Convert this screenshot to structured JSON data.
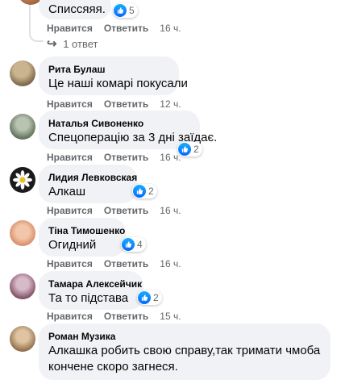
{
  "colors": {
    "bubble": "#f0f2f5",
    "action_text": "#65676b",
    "like_blue": "#0866ff"
  },
  "labels": {
    "like": "Нравится",
    "reply": "Ответить"
  },
  "top_comment": {
    "text": "Списсяяя.",
    "reactions": "5",
    "time": "16 ч.",
    "replies_link": "1 ответ"
  },
  "comments": [
    {
      "author": "Рита Булаш",
      "text": "Це наші комарі покусали",
      "time": "12 ч.",
      "reactions": "",
      "avatar_icon": "photo-avatar"
    },
    {
      "author": "Наталья Сивоненко",
      "text": "Спецоперацію за 3 дні заїдає.",
      "time": "16 ч.",
      "reactions": "2",
      "avatar_icon": "photo-avatar"
    },
    {
      "author": "Лидия Левковская",
      "text": "Алкаш",
      "time": "16 ч.",
      "reactions": "2",
      "avatar_icon": "daisy-avatar"
    },
    {
      "author": "Тіна Тимошенко",
      "text": "Огидний",
      "time": "16 ч.",
      "reactions": "4",
      "avatar_icon": "photo-avatar"
    },
    {
      "author": "Тамара Алексейчик",
      "text": "Та то підстава",
      "time": "15 ч.",
      "reactions": "2",
      "avatar_icon": "photo-avatar"
    },
    {
      "author": "Роман Музика",
      "text_line1": "Алкашка робить свою справу,так тримати чмоба",
      "text_line2": "кончене скоро загнеся.",
      "avatar_icon": "photo-avatar"
    }
  ]
}
